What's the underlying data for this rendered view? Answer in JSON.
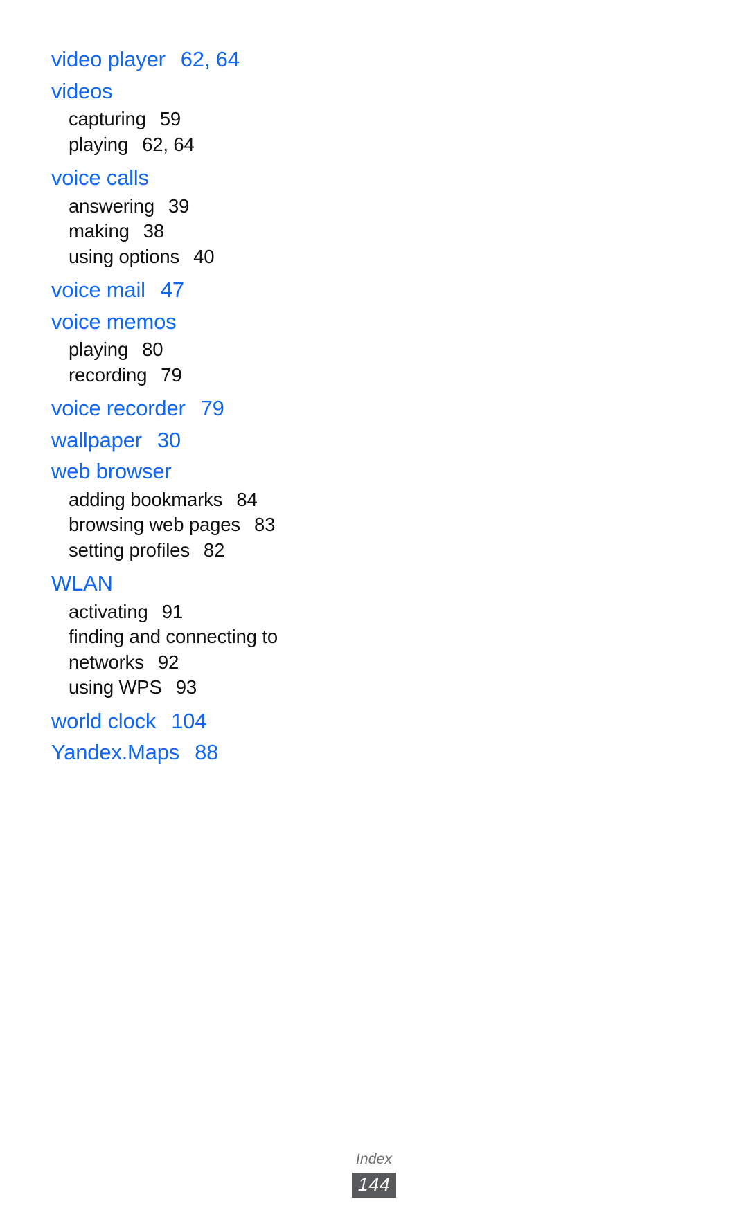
{
  "document": {
    "section_label": "Index",
    "page_number": "144",
    "accent_color": "#1166f2",
    "body_color": "#111111",
    "footer_label_color": "#6d6e70",
    "footer_badge_color": "#58595b"
  },
  "entries": [
    {
      "label": "video player",
      "pages": "62, 64",
      "subentries": []
    },
    {
      "label": "videos",
      "pages": "",
      "subentries": [
        {
          "label": "capturing",
          "pages": "59"
        },
        {
          "label": "playing",
          "pages": "62, 64"
        }
      ]
    },
    {
      "label": "voice calls",
      "pages": "",
      "subentries": [
        {
          "label": "answering",
          "pages": "39"
        },
        {
          "label": "making",
          "pages": "38"
        },
        {
          "label": "using options",
          "pages": "40"
        }
      ]
    },
    {
      "label": "voice mail",
      "pages": "47",
      "subentries": []
    },
    {
      "label": "voice memos",
      "pages": "",
      "subentries": [
        {
          "label": "playing",
          "pages": "80"
        },
        {
          "label": "recording",
          "pages": "79"
        }
      ]
    },
    {
      "label": "voice recorder",
      "pages": "79",
      "subentries": []
    },
    {
      "label": "wallpaper",
      "pages": "30",
      "subentries": []
    },
    {
      "label": "web browser",
      "pages": "",
      "subentries": [
        {
          "label": "adding bookmarks",
          "pages": "84"
        },
        {
          "label": "browsing web pages",
          "pages": "83"
        },
        {
          "label": "setting profiles",
          "pages": "82"
        }
      ]
    },
    {
      "label": "WLAN",
      "pages": "",
      "subentries": [
        {
          "label": "activating",
          "pages": "91"
        },
        {
          "label": "finding and connecting to networks",
          "pages": "92",
          "wrap": true
        },
        {
          "label": "using WPS",
          "pages": "93"
        }
      ]
    },
    {
      "label": "world clock",
      "pages": "104",
      "subentries": []
    },
    {
      "label": "Yandex.Maps",
      "pages": "88",
      "subentries": []
    }
  ]
}
